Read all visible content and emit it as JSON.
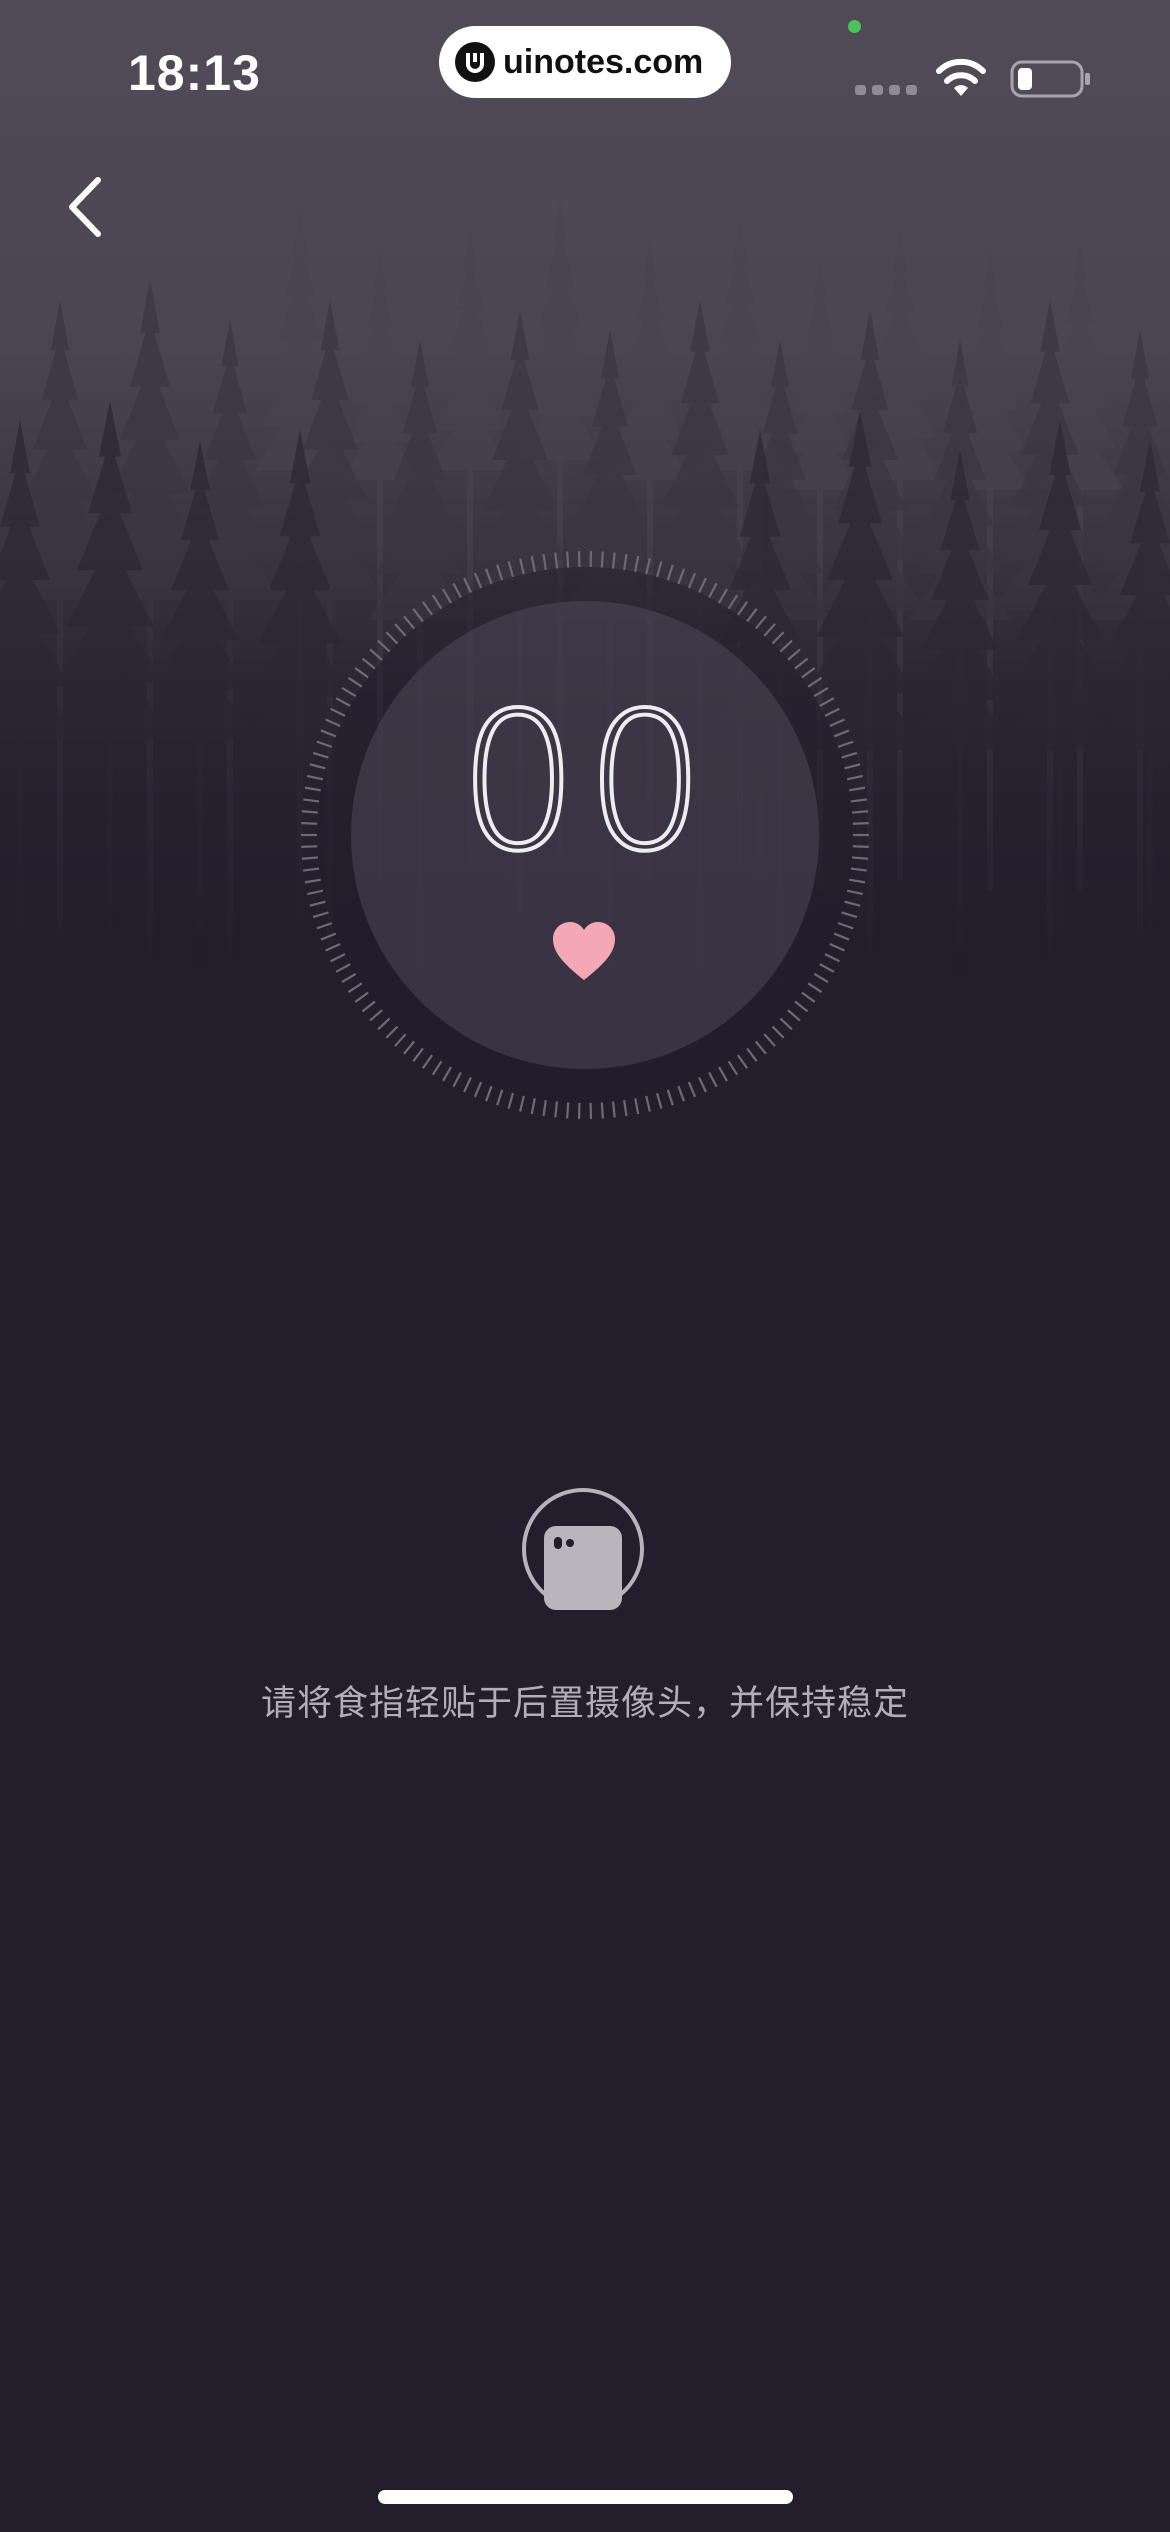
{
  "status_bar": {
    "time": "18:13",
    "watermark": "uinotes.com",
    "mic_dot_color": "#4cc25a"
  },
  "nav": {
    "back_icon": "chevron-left-icon"
  },
  "measurement": {
    "bpm": "00",
    "heart_color": "#f4a7b5",
    "heart_icon": "heart-icon"
  },
  "instruction": {
    "camera_icon": "phone-camera-icon",
    "text": "请将食指轻贴于后置摄像头，并保持稳定"
  },
  "colors": {
    "background": "#231d2c",
    "accent": "#f4a7b5"
  }
}
